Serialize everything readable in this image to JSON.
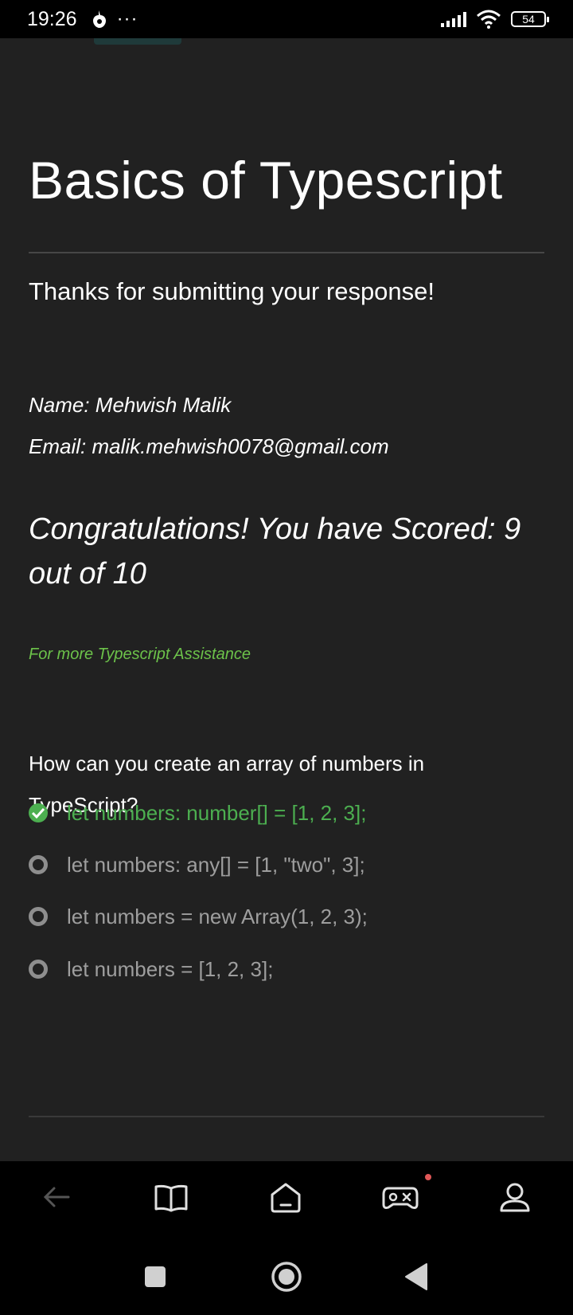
{
  "status_bar": {
    "time": "19:26",
    "dots": "···",
    "battery": "54"
  },
  "page": {
    "title": "Basics of Typescript",
    "thanks": "Thanks for submitting your response!",
    "name_line": "Name: Mehwish Malik",
    "email_line": "Email: malik.mehwish0078@gmail.com",
    "score_line": "Congratulations! You have Scored: 9 out of 10",
    "assistance_link": "For more Typescript Assistance",
    "question": "How can you create an array of numbers in TypeScript?",
    "options": [
      {
        "label": "let numbers: number[] = [1, 2, 3];",
        "selected": true
      },
      {
        "label": "let numbers: any[] = [1, \"two\", 3];",
        "selected": false
      },
      {
        "label": "let numbers = new Array(1, 2, 3);",
        "selected": false
      },
      {
        "label": "let numbers = [1, 2, 3];",
        "selected": false
      }
    ]
  },
  "colors": {
    "background": "#212121",
    "correct": "#4caf50",
    "assist_link": "#6cc24a",
    "option_gray": "#9e9e9e",
    "notification": "#e05757"
  },
  "icons": {
    "nav": [
      "back-arrow-icon",
      "book-icon",
      "home-icon",
      "gamepad-icon",
      "profile-icon"
    ],
    "system": [
      "square-icon",
      "circle-icon",
      "triangle-back-icon"
    ]
  }
}
